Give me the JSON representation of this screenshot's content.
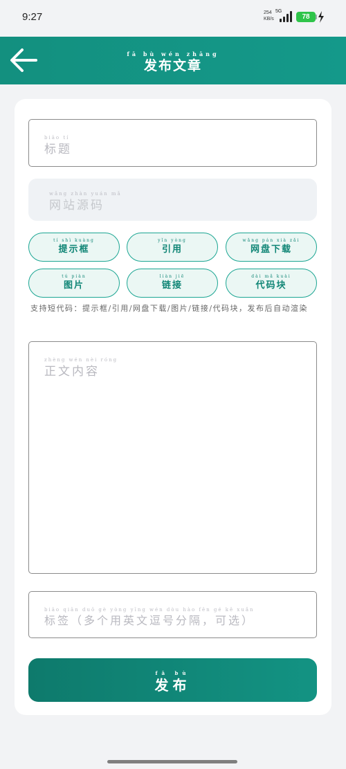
{
  "status_bar": {
    "time": "9:27",
    "net_speed_value": "254",
    "net_speed_unit": "KB/s",
    "network_type": "5G",
    "battery_level": "78"
  },
  "header": {
    "title": "发布文章",
    "title_pinyin": "fā bù wén zhāng"
  },
  "form": {
    "title_placeholder": "标题",
    "title_placeholder_pinyin": "biāo tí",
    "source_placeholder": "网站源码",
    "source_placeholder_pinyin": "wǎng zhàn yuán mǎ",
    "shortcodes": [
      {
        "label": "提示框",
        "pinyin": "tí shì kuàng"
      },
      {
        "label": "引用",
        "pinyin": "yǐn yòng"
      },
      {
        "label": "网盘下载",
        "pinyin": "wǎng pán xià zǎi"
      },
      {
        "label": "图片",
        "pinyin": "tú piàn"
      },
      {
        "label": "链接",
        "pinyin": "liàn jiē"
      },
      {
        "label": "代码块",
        "pinyin": "dài mǎ kuài"
      }
    ],
    "hint": "支持短代码：提示框/引用/网盘下载/图片/链接/代码块，发布后自动渲染",
    "body_placeholder": "正文内容",
    "body_placeholder_pinyin": "zhèng wén nèi róng",
    "tags_placeholder": "标签（多个用英文逗号分隔，可选）",
    "tags_placeholder_pinyin": "biāo qiān duō gè yòng yīng wén dòu hào fēn gé kě xuǎn",
    "publish_label": "发布",
    "publish_pinyin": "fā bù"
  },
  "colors": {
    "accent": "#13907f",
    "chip_bg": "#ebf7f4",
    "chip_border": "#1aa592",
    "battery": "#2fc44a"
  }
}
